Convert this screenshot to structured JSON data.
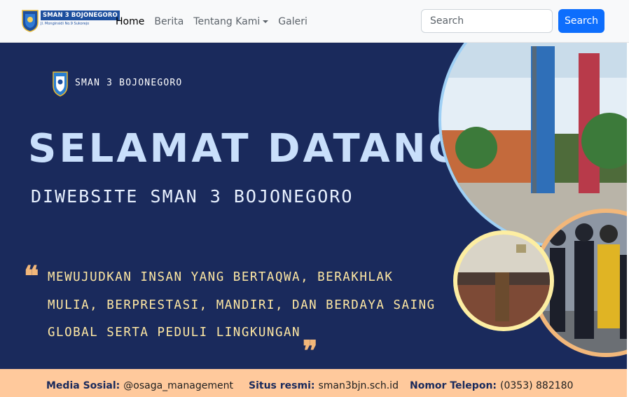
{
  "navbar": {
    "brand_top": "SMAN 3 BOJONEGORO",
    "brand_bottom": "Jl. Monginsidi No.9 Sukorejo",
    "links": [
      {
        "label": "Home",
        "active": true
      },
      {
        "label": "Berita",
        "active": false
      },
      {
        "label": "Tentang Kami",
        "active": false,
        "dropdown": true
      },
      {
        "label": "Galeri",
        "active": false
      }
    ],
    "search_placeholder": "Search",
    "search_button": "Search"
  },
  "hero": {
    "school_name": "SMAN 3 BOJONEGORO",
    "title": "SELAMAT DATANG",
    "subtitle": "DIWEBSITE SMAN 3 BOJONEGORO",
    "quote_open": "❝",
    "quote_close": "❝",
    "motto_lines": [
      "MEWUJUDKAN INSAN YANG BERTAQWA, BERAKHLAK",
      "MULIA, BERPRESTASI, MANDIRI, DAN BERDAYA SAING",
      "GLOBAL SERTA PEDULI LINGKUNGAN"
    ]
  },
  "footer": {
    "social_label": "Media Sosial:",
    "social_value": "@osaga_management",
    "site_label": "Situs resmi:",
    "site_value": "sman3bjn.sch.id",
    "phone_label": "Nomor Telepon:",
    "phone_value": "(0353) 882180"
  },
  "colors": {
    "hero_bg": "#1a2a5c",
    "title": "#c9dffb",
    "motto": "#ffe8a3",
    "quote": "#f2b77a",
    "footer_bg": "#ffc99c",
    "search_button": "#0d6efd"
  },
  "icons": {
    "brand_logo": "school-shield-icon",
    "hero_logo": "school-shield-icon",
    "dropdown": "caret-down-icon"
  }
}
